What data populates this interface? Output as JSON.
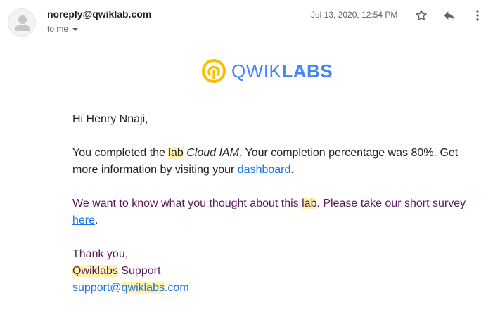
{
  "header": {
    "sender": "noreply@qwiklab.com",
    "recipient": "to me",
    "date": "Jul 13, 2020, 12:54 PM",
    "icons": [
      "avatar",
      "star-icon",
      "reply-icon",
      "more-vert-icon",
      "chevron-down-icon"
    ]
  },
  "logo": {
    "part1": "QWIK",
    "part2": "LABS"
  },
  "body": {
    "greeting": "Hi Henry Nnaji,",
    "p1_pre": "You completed the ",
    "p1_hl": "lab",
    "p1_space": " ",
    "p1_lab_name": "Cloud IAM",
    "p1_mid": ". Your completion percentage was 80%. Get more information by visiting your ",
    "p1_link": "dashboard",
    "p1_end": ".",
    "p2_pre": "We want to know what you thought about this ",
    "p2_hl": "lab",
    "p2_mid": ". Please take our short survey ",
    "p2_link": "here",
    "p2_end": ".",
    "thanks": "Thank you,",
    "sig_hl": "Qwiklabs",
    "sig_rest": " Support",
    "email_pre": "support@",
    "email_hl": "qwiklabs",
    "email_end": ".com"
  },
  "colors": {
    "link": "#1a73e8",
    "highlight": "#fff3b0",
    "purple_text": "#5a1a55",
    "logo_blue": "#4285f4",
    "logo_yellow": "#f9c000"
  }
}
